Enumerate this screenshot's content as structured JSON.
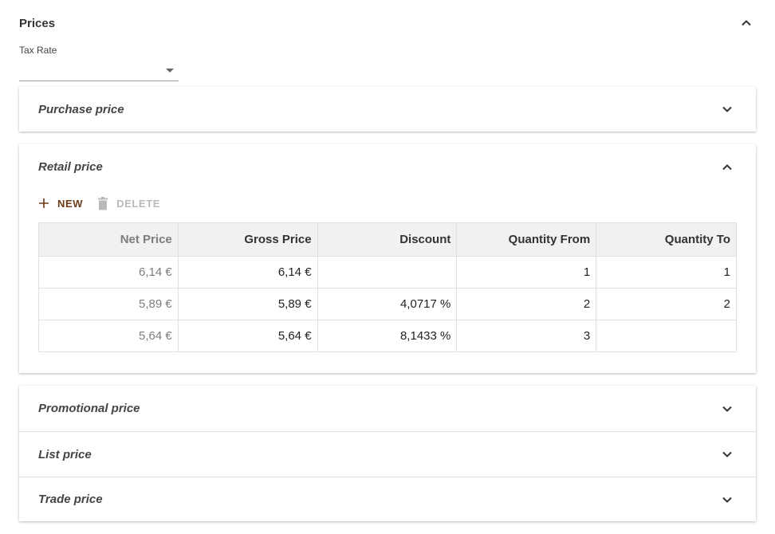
{
  "prices": {
    "title": "Prices",
    "tax_rate": {
      "label": "Tax Rate",
      "value": ""
    }
  },
  "panels": {
    "purchase": {
      "title": "Purchase price"
    },
    "retail": {
      "title": "Retail price",
      "toolbar": {
        "new_label": "NEW",
        "delete_label": "DELETE"
      },
      "columns": [
        "Net Price",
        "Gross Price",
        "Discount",
        "Quantity From",
        "Quantity To"
      ],
      "rows": [
        [
          "6,14 €",
          "6,14 €",
          "",
          "1",
          "1"
        ],
        [
          "5,89 €",
          "5,89 €",
          "4,0717 %",
          "2",
          "2"
        ],
        [
          "5,64 €",
          "5,64 €",
          "8,1433 %",
          "3",
          ""
        ]
      ]
    },
    "promotional": {
      "title": "Promotional price"
    },
    "list": {
      "title": "List price"
    },
    "trade": {
      "title": "Trade price"
    }
  },
  "colors": {
    "accent": "#6d3b1a",
    "disabled": "#b9b9b9",
    "header_bg": "#f1f1f1"
  }
}
